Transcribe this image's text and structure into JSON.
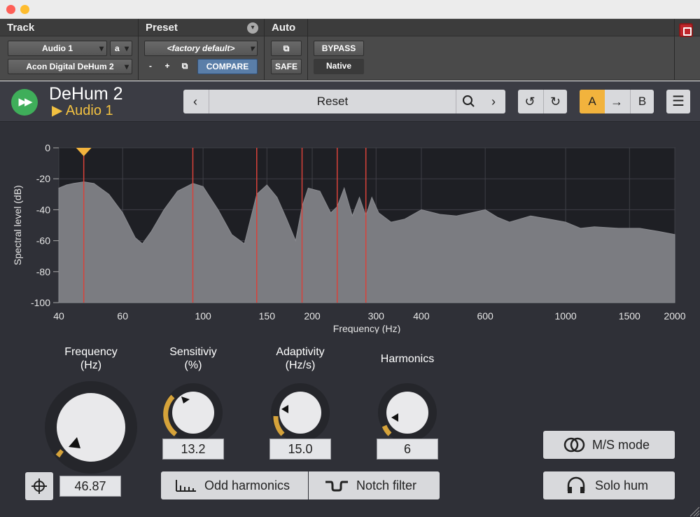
{
  "host": {
    "track_header": "Track",
    "preset_header": "Preset",
    "auto_header": "Auto",
    "track_name": "Audio 1",
    "track_channel": "a",
    "insert_name": "Acon Digital DeHum 2",
    "preset_name": "<factory default>",
    "minus_label": "-",
    "plus_label": "+",
    "compare_label": "COMPARE",
    "safe_label": "SAFE",
    "bypass_label": "BYPASS",
    "native_label": "Native"
  },
  "plugin": {
    "title": "DeHum 2",
    "track": "Audio 1",
    "preset": "Reset",
    "ab_a": "A",
    "ab_b": "B"
  },
  "chart_data": {
    "type": "area",
    "ylabel": "Spectral level (dB)",
    "xlabel": "Frequency (Hz)",
    "x_scale": "log",
    "xlim": [
      40,
      2000
    ],
    "ylim": [
      -100,
      0
    ],
    "x_ticks": [
      40,
      60,
      100,
      150,
      200,
      300,
      400,
      600,
      1000,
      1500,
      2000
    ],
    "y_ticks": [
      0,
      -20,
      -40,
      -60,
      -80,
      -100
    ],
    "grid": true,
    "hum_lines_hz": [
      46.87,
      93.7,
      140.6,
      187.5,
      234.4,
      281.2
    ],
    "fundamental_marker_hz": 46.87,
    "spectrum": [
      [
        40,
        -26
      ],
      [
        42,
        -24
      ],
      [
        44,
        -23
      ],
      [
        46.87,
        -22
      ],
      [
        50,
        -23
      ],
      [
        55,
        -30
      ],
      [
        60,
        -42
      ],
      [
        65,
        -58
      ],
      [
        68,
        -62
      ],
      [
        72,
        -54
      ],
      [
        78,
        -40
      ],
      [
        85,
        -28
      ],
      [
        93.7,
        -23
      ],
      [
        100,
        -25
      ],
      [
        110,
        -40
      ],
      [
        120,
        -56
      ],
      [
        130,
        -62
      ],
      [
        140.6,
        -30
      ],
      [
        150,
        -24
      ],
      [
        160,
        -32
      ],
      [
        170,
        -46
      ],
      [
        180,
        -60
      ],
      [
        187.5,
        -38
      ],
      [
        195,
        -26
      ],
      [
        210,
        -28
      ],
      [
        225,
        -42
      ],
      [
        234.4,
        -38
      ],
      [
        245,
        -26
      ],
      [
        258,
        -44
      ],
      [
        270,
        -32
      ],
      [
        281.2,
        -44
      ],
      [
        292,
        -32
      ],
      [
        305,
        -42
      ],
      [
        330,
        -48
      ],
      [
        360,
        -46
      ],
      [
        400,
        -40
      ],
      [
        450,
        -43
      ],
      [
        500,
        -44
      ],
      [
        550,
        -42
      ],
      [
        600,
        -40
      ],
      [
        650,
        -45
      ],
      [
        700,
        -48
      ],
      [
        800,
        -44
      ],
      [
        900,
        -46
      ],
      [
        1000,
        -48
      ],
      [
        1100,
        -52
      ],
      [
        1200,
        -51
      ],
      [
        1400,
        -52
      ],
      [
        1600,
        -52
      ],
      [
        1800,
        -54
      ],
      [
        2000,
        -56
      ]
    ]
  },
  "controls": {
    "frequency_label": "Frequency",
    "frequency_unit": "(Hz)",
    "frequency_value": "46.87",
    "sensitivity_label": "Sensitiviy",
    "sensitivity_unit": "(%)",
    "sensitivity_value": "13.2",
    "adaptivity_label": "Adaptivity",
    "adaptivity_unit": "(Hz/s)",
    "adaptivity_value": "15.0",
    "harmonics_label": "Harmonics",
    "harmonics_value": "6",
    "odd_harmonics_label": "Odd harmonics",
    "notch_filter_label": "Notch filter",
    "ms_mode_label": "M/S mode",
    "solo_hum_label": "Solo hum"
  },
  "colors": {
    "accent": "#f2b33d",
    "hum_line": "#d9423a",
    "play": "#3fae5a",
    "compare": "#5a7ea8"
  }
}
